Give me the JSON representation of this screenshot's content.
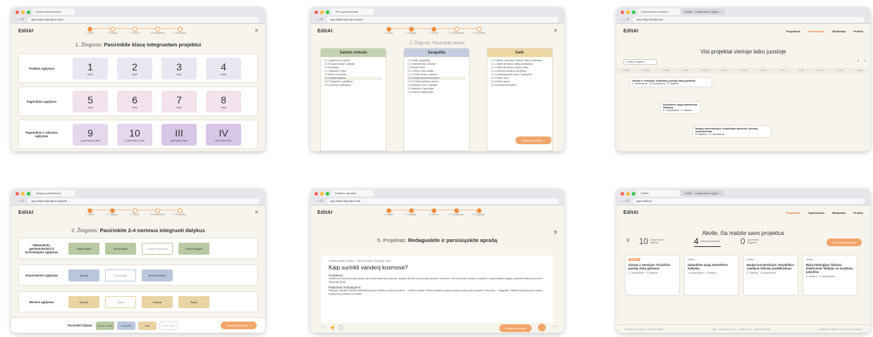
{
  "colors": {
    "accent": "#f2a66a",
    "green": "#b9c9a3",
    "blue": "#b9c7de",
    "sand": "#ead3a3",
    "lilac": "#e6dcef"
  },
  "common": {
    "logo": "EditAI",
    "close": "×",
    "steps": [
      "1. Klasė",
      "2. Dalykai",
      "3. Temos",
      "4. Kontekstas",
      "5. Projektas"
    ]
  },
  "shot1": {
    "tab": "Klasės pasirinkimas",
    "url": "app.editai.ai/project-class",
    "heading_prefix": "1. Žingsnis:",
    "heading": "Pasirinkite klasę integruotam projektui",
    "rows": [
      {
        "label": "Pradinis ugdymas",
        "cards": [
          {
            "n": "1",
            "s": "klasė"
          },
          {
            "n": "2",
            "s": "klasė"
          },
          {
            "n": "3",
            "s": "klasė"
          },
          {
            "n": "4",
            "s": "klasė"
          }
        ]
      },
      {
        "label": "Pagrindinis ugdymas",
        "cards": [
          {
            "n": "5",
            "s": "klasė"
          },
          {
            "n": "6",
            "s": "klasė"
          },
          {
            "n": "7",
            "s": "klasė"
          },
          {
            "n": "8",
            "s": "klasė"
          }
        ]
      },
      {
        "label": "Pagrindinis ir vidurinis ugdymas",
        "cards": [
          {
            "n": "9",
            "s": "(I gimnazijos) klasė"
          },
          {
            "n": "10",
            "s": "(II gimnazijos) klasė"
          },
          {
            "n": "III",
            "s": "gimnazijos klasė"
          },
          {
            "n": "IV",
            "s": "gimnazijos klasė"
          }
        ]
      }
    ]
  },
  "shot2": {
    "tab": "Temų pasirinkimas",
    "url": "app.editai.ai/project-topics",
    "subheading": "3. Žingsnis: Pasirinkite temas",
    "columns": [
      {
        "title": "Gamtos mokslai",
        "items": [
          "2.1 Organizmas ir aplinka",
          "2.2 Žmogaus kūnas ir sveikata",
          "2.3 Medžiagos",
          "2.4 Judėjimas ir jėgos",
          "2.5 Žemė ir kosmosas",
          "2.5.1 Saulės sistema",
          "2.5.2 Žvaigždės ir galaktikos",
          "2.5.3 Kosmoso tyrinėjimas"
        ]
      },
      {
        "title": "Geografija",
        "items": [
          "2.1 Įvadas į geografiją",
          "2.2 Orientavimasis vietovėje",
          "2.3 Planeta Žemė",
          "2.3.1 Žemės vieta visatoje",
          "2.3.2 Žemės Ichnė ir vandens",
          "2.3.3 Vandenų žemės vandenys",
          "2.3.4 Žemės paviršiaus formos",
          "2.4 Atmosfera, orai ir klimatas",
          "2.5 Valstybės ir gyventojai",
          "2.6 Lietuvos kraštovaizdis"
        ]
      },
      {
        "title": "Dailė",
        "items": [
          "2.1 Grafinės, spalvinės, erdvinės raiškos pažinimas",
          "2.1.1 Dailės technikos: raiška plokštumoje",
          "2.1.2 Dailės technikos: erdvinė raiška",
          "2.1.3 Menininkų kūrybos tyrinėjimas",
          "2.1.4 Vaizduojamasis menas ir galimybės",
          "2.1.5 Dailės rūšys",
          "2.1.6 Dailės žanrai",
          "2.2 Sociokultūrinė aplinka"
        ]
      }
    ],
    "cta": "Sukurti pamokos →"
  },
  "shot3": {
    "tab": "Kalendoriaus peržiūra",
    "tab2": "EditAI – Integruotas ugdym...",
    "url": "app.editai.ai/calendar",
    "nav": [
      "Projektinis",
      "Kalendorius",
      "Biblioteka",
      "Profilis"
    ],
    "title": "Visi projektai vienoje laiko juostoje",
    "search": "Mano projektai",
    "timeline": [
      "20 Sau",
      "25 Sau",
      "30 Sau",
      "5 Vas",
      "10 Vas",
      "15 Vas",
      "20 Vas",
      "25 Vas",
      "1 Kov",
      "5 Kov",
      "10 Kov",
      "15 Kov",
      "20 Kov"
    ],
    "events": [
      {
        "title": "Garsas ir emocijos: kriaušinio poezija ritmą gimtuvai",
        "meta": "K. Jonkevičienė · A. Kraučiūnienė · Š. Šalčienė"
      },
      {
        "title": "Sukurkime naują atmosferos šaldymą",
        "meta": "A. Kraučiūnienė · D. Nokienė"
      },
      {
        "title": "Naujos konstrukcijos: kūrybiškas vandenis liežuvių modeliavimas",
        "meta": "Š. Šalčienė · A. Kraučiūnienė"
      }
    ]
  },
  "shot4": {
    "tab": "Dalykų pasirinkimas",
    "url": "app.editai.ai/project-subjects",
    "heading_prefix": "2. Žingsnis:",
    "heading": "Pasirinkite 2-4 norimus integruoti dalykus",
    "rows": [
      {
        "label": "Matematinis, gamtamokslinis ir technologinis ugdymas",
        "chips": [
          "Matematika",
          "Informatika",
          "Gamtos mokslai",
          "Technologijos"
        ]
      },
      {
        "label": "Visuomeninis ugdymas",
        "chips": [
          "Istorija",
          "Geografija",
          "Etninė kultūra"
        ]
      },
      {
        "label": "Meninis ugdymas",
        "chips": [
          "Muzika",
          "Dailė",
          "Teatras",
          "Šokis"
        ]
      }
    ],
    "tray_label": "Pasirinkti dalykai:",
    "selected": [
      "Gamtos mokslai",
      "Geografija",
      "Dailė",
      "Įtraukti dalyką"
    ],
    "cta": "Sukurti pamokos →"
  },
  "shot5": {
    "tab": "Projekto aprašas",
    "url": "app.editai.ai/project-edit",
    "heading_prefix": "5. Projektas:",
    "heading": "Redaguokite ir parsisiųskite aprašą",
    "meta": "Projekto aprašas: 6 klasė – Gamtos mokslai, Geografija, Dailė",
    "title": "Kaip surinkti vandenį kosmose?",
    "problem_title": "Problema:",
    "problem": "Mokiniai turi sukurti inovatyvų būdą, kaip surinkti vandenį iš kosmoso, supranti vandens svarbą mūsų planetai ir žmonėms. Jie turės tyrinėti vandenį, jo savybes ir astronomiškas sąlygas, panaudoti dailės priemones ir žinias apie Žemę.",
    "tips_title": "Patarimai mokytojams:",
    "tips": "Mokytojai, siekdami mokinius išdėstyti įtraukių ir kūrybiškų mokymosi patirčių. – Gamtos mokslai: Padėti mokiniams suprasti vandens svarbą mūsų planetai ir žmonėms. – Geografija: Pateikti informaciją apie vandens svarbą mūsų planetai ir žmonėms.",
    "cta": "Sukurti pamokos"
  },
  "shot6": {
    "tab": "EditAI",
    "tab2": "EditAI – Integruotas ugdym...",
    "url": "app.editai.ai",
    "nav": [
      "Projektinis",
      "Kalendorius",
      "Biblioteka",
      "Profilis"
    ],
    "title": "Akvile, čia matote savo projektus",
    "stats": [
      {
        "num": "10",
        "label": "Sugeneruoti aprašai"
      },
      {
        "num": "4",
        "label": "Einamieji projektai"
      },
      {
        "num": "0",
        "label": "Įgyvendinti projektai"
      }
    ],
    "cta": "Kurti naują projektą",
    "cards": [
      {
        "badge": "Skubus",
        "title": "Garsas ir emocijos: kriaušinio poezija ritmą gimtuvai",
        "meta": "K. Jonkevičienė · Š. Šalčienė"
      },
      {
        "badge": "Kūrimo",
        "title": "Sukurkime naują atmosferos šaldymą",
        "meta": "A. Kraučiūnienė · D. Nokienė"
      },
      {
        "badge": "Kūrimo",
        "title": "Naujos konstrukcijos: kūrybiškas vandenis liežuvių modeliavimas",
        "meta": "Š. Šalčienė · A. Kraučiūnienė"
      },
      {
        "badge": "Kūrimo",
        "title": "Bažų mitologijos žiūrimai elektroninis leidinys su muzikiniu palydimu",
        "meta": "D. Nokienė · A. Kraučiūnienė"
      }
    ],
    "footer_left": "Naudojimosi taisyklės · Privatumo politika",
    "footer_mid": "DUK · Naudotojo vadovas · info@editai.eu · +370 620 46 696",
    "footer_right": "© 2024 Edit. LEARNT. Visos teisės saugomos"
  }
}
